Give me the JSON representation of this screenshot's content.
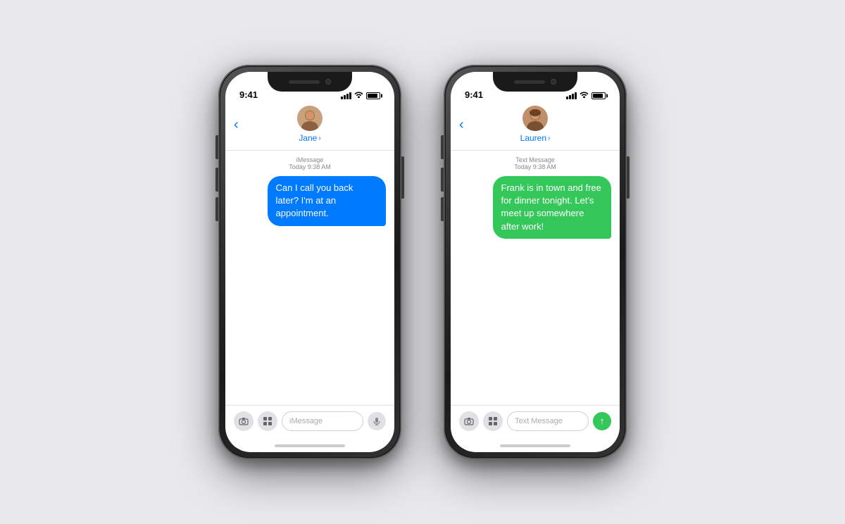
{
  "background_color": "#e8e8ed",
  "phone_left": {
    "id": "imessage-phone",
    "status_bar": {
      "time": "9:41",
      "signal_label": "signal",
      "wifi_label": "wifi",
      "battery_label": "battery"
    },
    "nav": {
      "back_label": "‹",
      "contact_name": "Jane",
      "chevron": "›"
    },
    "message_meta": {
      "type": "iMessage",
      "timestamp": "Today 9:38 AM"
    },
    "bubble": {
      "text": "Can I call you back later? I'm at an appointment.",
      "color": "blue"
    },
    "input": {
      "camera_icon": "📷",
      "apps_icon": "❖",
      "placeholder": "iMessage",
      "audio_icon": "⏺"
    }
  },
  "phone_right": {
    "id": "sms-phone",
    "status_bar": {
      "time": "9:41",
      "signal_label": "signal",
      "wifi_label": "wifi",
      "battery_label": "battery"
    },
    "nav": {
      "back_label": "‹",
      "contact_name": "Lauren",
      "chevron": "›"
    },
    "message_meta": {
      "type": "Text Message",
      "timestamp": "Today 9:38 AM"
    },
    "bubble": {
      "text": "Frank is in town and free for dinner tonight. Let's meet up somewhere after work!",
      "color": "green"
    },
    "input": {
      "camera_icon": "📷",
      "apps_icon": "❖",
      "placeholder": "Text Message",
      "send_icon": "↑"
    }
  }
}
